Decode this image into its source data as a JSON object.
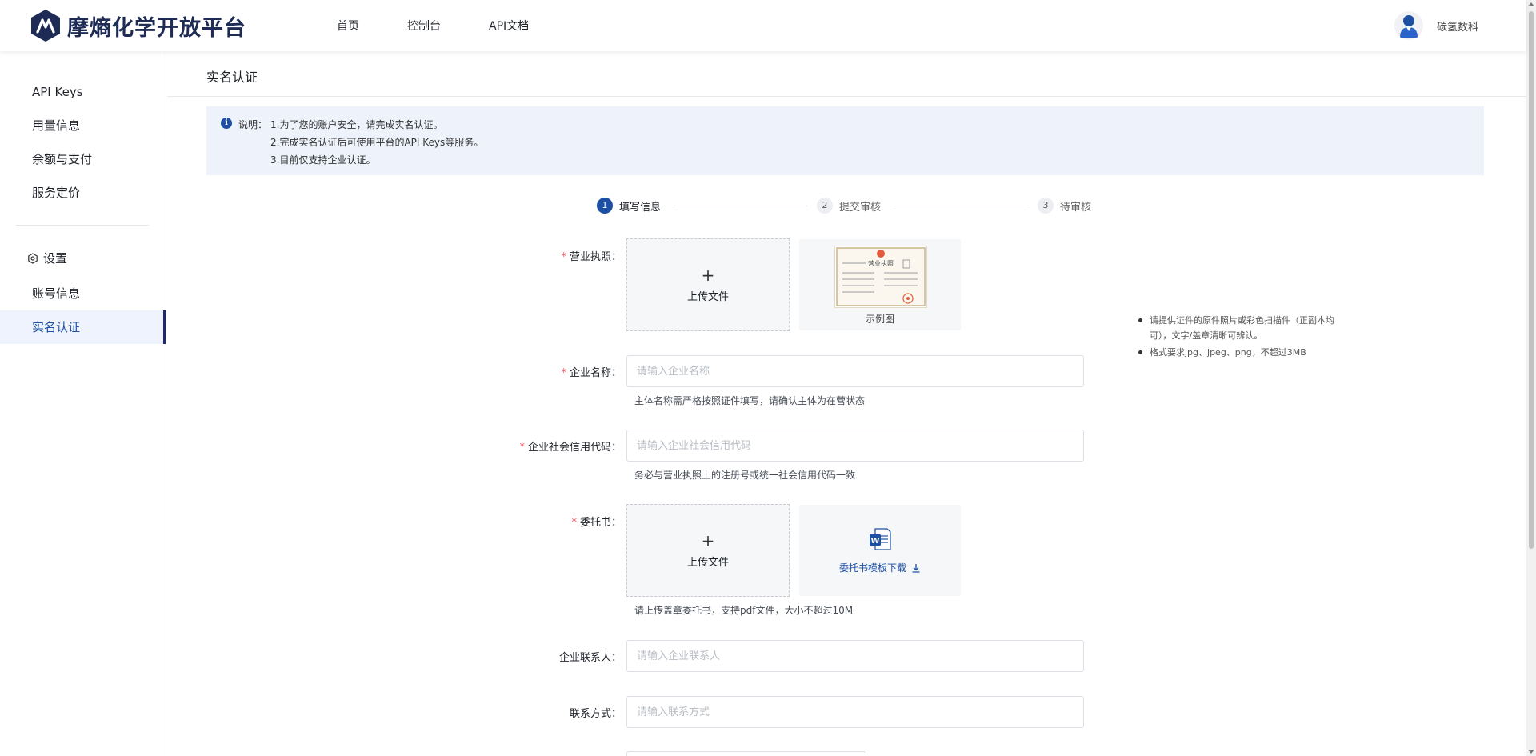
{
  "header": {
    "brand": "摩熵化学开放平台",
    "nav": [
      "首页",
      "控制台",
      "API文档"
    ],
    "user_name": "碳氢数科",
    "brand_color": "#1d2b55"
  },
  "sidebar": {
    "items": [
      "API Keys",
      "用量信息",
      "余额与支付",
      "服务定价"
    ],
    "section_title": "设置",
    "section_items": [
      "账号信息",
      "实名认证"
    ],
    "active_item": "实名认证"
  },
  "page": {
    "title": "实名认证",
    "notice": {
      "label": "说明：",
      "lines": [
        "1.为了您的账户安全，请完成实名认证。",
        "2.完成实名认证后可使用平台的API Keys等服务。",
        "3.目前仅支持企业认证。"
      ]
    },
    "steps": [
      {
        "num": "1",
        "label": "填写信息"
      },
      {
        "num": "2",
        "label": "提交审核"
      },
      {
        "num": "3",
        "label": "待审核"
      }
    ],
    "license": {
      "label": "营业执照：",
      "upload_text": "上传文件",
      "sample_caption": "示例图",
      "sample_title": "营业执照",
      "tips": [
        "请提供证件的原件照片或彩色扫描件（正副本均可），文字/盖章清晰可辨认。",
        "格式要求jpg、jpeg、png，不超过3MB"
      ]
    },
    "company_name": {
      "label": "企业名称：",
      "placeholder": "请输入企业名称",
      "hint": "主体名称需严格按照证件填写，请确认主体为在营状态"
    },
    "credit_code": {
      "label": "企业社会信用代码：",
      "placeholder": "请输入企业社会信用代码",
      "hint": "务必与营业执照上的注册号或统一社会信用代码一致"
    },
    "letter": {
      "label": "委托书：",
      "upload_text": "上传文件",
      "template_link": "委托书模板下载",
      "hint": "请上传盖章委托书，支持pdf文件，大小不超过10M"
    },
    "contact_person": {
      "label": "企业联系人：",
      "placeholder": "请输入企业联系人"
    },
    "contact_method": {
      "label": "联系方式：",
      "placeholder": "请输入联系方式"
    },
    "accent_color": "#1d4fa3",
    "required_color": "#e34d59"
  }
}
